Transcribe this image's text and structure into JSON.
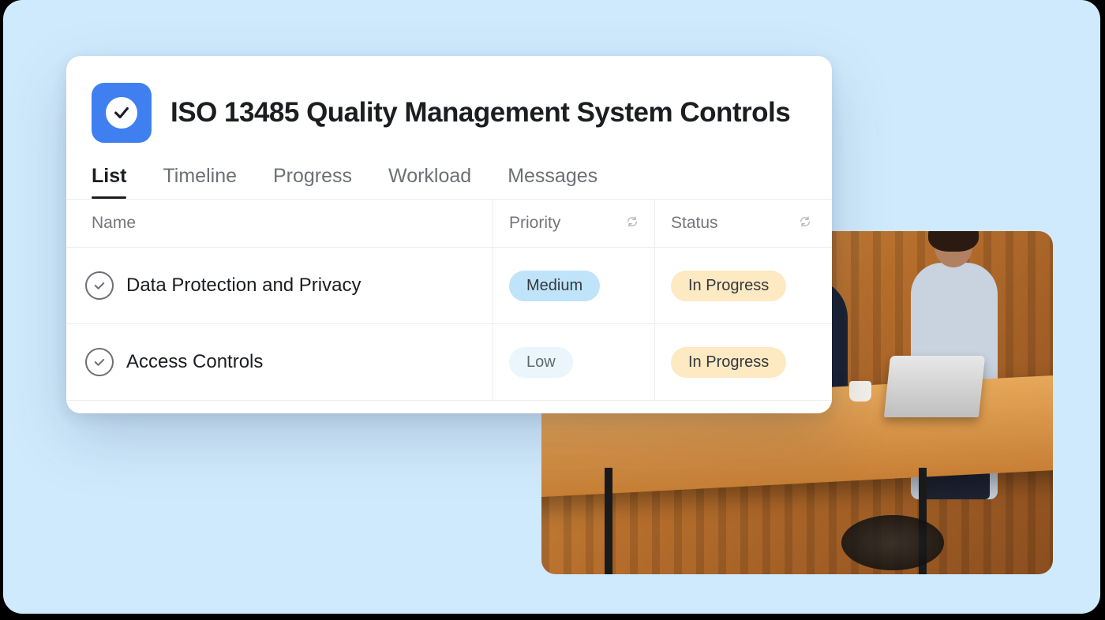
{
  "header": {
    "title": "ISO 13485 Quality Management System Controls"
  },
  "tabs": [
    {
      "label": "List",
      "active": true
    },
    {
      "label": "Timeline",
      "active": false
    },
    {
      "label": "Progress",
      "active": false
    },
    {
      "label": "Workload",
      "active": false
    },
    {
      "label": "Messages",
      "active": false
    }
  ],
  "columns": {
    "name": "Name",
    "priority": "Priority",
    "status": "Status"
  },
  "rows": [
    {
      "name": "Data Protection and Privacy",
      "priority": {
        "label": "Medium",
        "style": "pill-medium"
      },
      "status": {
        "label": "In Progress",
        "style": "pill-inprogress"
      }
    },
    {
      "name": "Access Controls",
      "priority": {
        "label": "Low",
        "style": "pill-low"
      },
      "status": {
        "label": "In Progress",
        "style": "pill-inprogress"
      }
    }
  ]
}
